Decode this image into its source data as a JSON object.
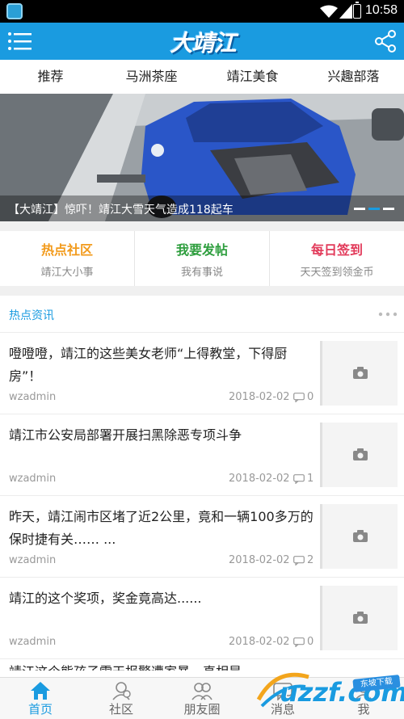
{
  "status_bar": {
    "time": "10:58"
  },
  "header": {
    "logo_text": "大靖江"
  },
  "tabs": [
    {
      "label": "推荐"
    },
    {
      "label": "马洲茶座"
    },
    {
      "label": "靖江美食"
    },
    {
      "label": "兴趣部落"
    }
  ],
  "banner": {
    "caption": "【大靖江】惊吓！靖江大雪天气造成118起车",
    "dots_total": 3,
    "dots_active_index": 1
  },
  "quick_links": [
    {
      "title": "热点社区",
      "subtitle": "靖江大小事",
      "color": "#f29a1b"
    },
    {
      "title": "我要发帖",
      "subtitle": "我有事说",
      "color": "#2e9e3e"
    },
    {
      "title": "每日签到",
      "subtitle": "天天签到领金币",
      "color": "#e23a5a"
    }
  ],
  "section": {
    "title": "热点资讯"
  },
  "news": [
    {
      "title": "噔噔噔，靖江的这些美女老师“上得教堂，下得厨房”！",
      "author": "wzadmin",
      "date": "2018-02-02",
      "comments": "0"
    },
    {
      "title": "靖江市公安局部署开展扫黑除恶专项斗争",
      "author": "wzadmin",
      "date": "2018-02-02",
      "comments": "1"
    },
    {
      "title": "昨天，靖江闹市区堵了近2公里，竟和一辆100多万的保时捷有关…… ...",
      "author": "wzadmin",
      "date": "2018-02-02",
      "comments": "2"
    },
    {
      "title": "靖江的这个奖项，奖金竟高达......",
      "author": "wzadmin",
      "date": "2018-02-02",
      "comments": "0"
    },
    {
      "title": "靖江这个熊孩子雪天报警遭家暴，真相是",
      "author": "",
      "date": "",
      "comments": ""
    }
  ],
  "bottom_nav": [
    {
      "label": "首页",
      "icon": "home-icon"
    },
    {
      "label": "社区",
      "icon": "community-icon"
    },
    {
      "label": "朋友圈",
      "icon": "friends-icon"
    },
    {
      "label": "消息",
      "icon": "message-icon"
    },
    {
      "label": "我",
      "icon": "profile-icon"
    }
  ],
  "watermark": {
    "text": "uzzf.com",
    "badge": "东坡下载"
  },
  "colors": {
    "brand": "#1a9be0",
    "hot": "#f29a1b",
    "post": "#2e9e3e",
    "checkin": "#e23a5a"
  }
}
